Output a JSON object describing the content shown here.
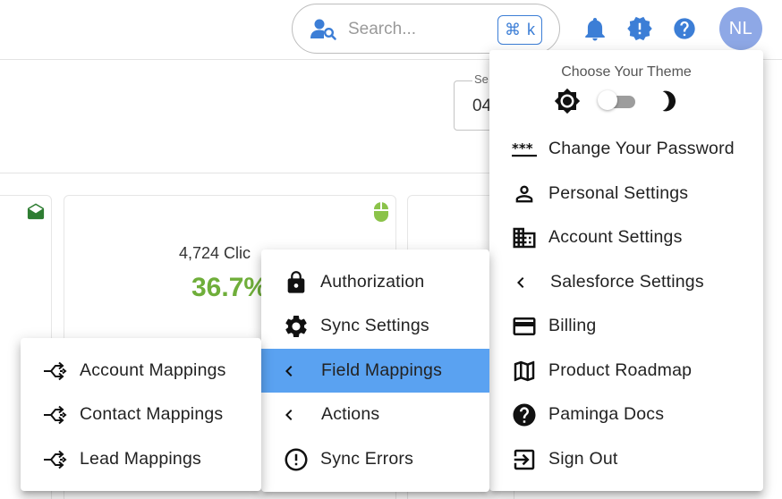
{
  "header": {
    "search": {
      "placeholder": "Search...",
      "shortcut_symbol": "⌘",
      "shortcut_key": "k"
    },
    "avatar_initials": "NL"
  },
  "background": {
    "date_field": {
      "label": "Se",
      "value": "04"
    },
    "card": {
      "clicks_label": "4,724 Clic",
      "clicks_percent": "36.7%"
    }
  },
  "user_menu": {
    "theme_title": "Choose Your Theme",
    "theme_dark_enabled": false,
    "items": [
      {
        "label": "Change Your Password",
        "icon": "password-icon"
      },
      {
        "label": "Personal Settings",
        "icon": "person-icon"
      },
      {
        "label": "Account Settings",
        "icon": "building-icon"
      },
      {
        "label": "Salesforce Settings",
        "icon": "chevron-left-icon"
      },
      {
        "label": "Billing",
        "icon": "credit-card-icon"
      },
      {
        "label": "Product Roadmap",
        "icon": "map-icon"
      },
      {
        "label": "Paminga Docs",
        "icon": "help-circle-icon"
      },
      {
        "label": "Sign Out",
        "icon": "logout-icon"
      }
    ]
  },
  "salesforce_menu": {
    "items": [
      {
        "label": "Authorization",
        "icon": "lock-icon"
      },
      {
        "label": "Sync Settings",
        "icon": "gear-icon"
      },
      {
        "label": "Field Mappings",
        "icon": "chevron-left-icon",
        "selected": true
      },
      {
        "label": "Actions",
        "icon": "chevron-left-icon"
      },
      {
        "label": "Sync Errors",
        "icon": "error-outline-icon"
      }
    ]
  },
  "field_mappings_menu": {
    "items": [
      {
        "label": "Account Mappings",
        "icon": "merge-icon"
      },
      {
        "label": "Contact Mappings",
        "icon": "merge-icon"
      },
      {
        "label": "Lead Mappings",
        "icon": "merge-icon"
      }
    ]
  },
  "colors": {
    "accent_blue": "#3c7ed6",
    "selected_item": "#5aa2f1",
    "success_green": "#6fae3a",
    "avatar_bg": "#8ea8e6",
    "dark_green_icon": "#2e7d32",
    "mouse_green": "#8bc34a"
  }
}
